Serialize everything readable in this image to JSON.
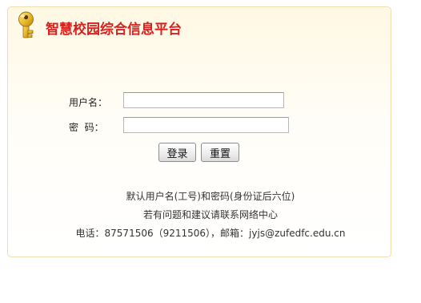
{
  "header": {
    "title": "智慧校园综合信息平台",
    "icon": "key-icon",
    "title_color": "#d8211f"
  },
  "login_form": {
    "username_label": "用户名：",
    "username_value": "",
    "password_label": "密  码：",
    "password_value": "",
    "login_button": "登录",
    "reset_button": "重置"
  },
  "notes": {
    "line1": "默认用户名(工号)和密码(身份证后六位)",
    "line2": "若有问题和建议请联系网络中心",
    "line3": "电话：87571506（9211506），邮箱：jyjs@zufedfc.edu.cn"
  },
  "colors": {
    "panel_border": "#f1ddb0",
    "panel_background": "#fff8e3",
    "key_gold": "#e9b82c"
  }
}
